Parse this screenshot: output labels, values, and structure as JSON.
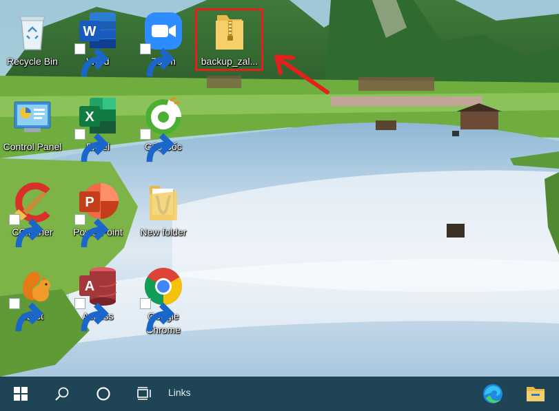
{
  "desktop": {
    "icons": [
      {
        "label": "Recycle Bin"
      },
      {
        "label": "Word"
      },
      {
        "label": "Zoom"
      },
      {
        "label": "backup_zal..."
      },
      {
        "label": "Control Panel"
      },
      {
        "label": "Excel"
      },
      {
        "label": "Cốc Cốc"
      },
      {
        "label": "CCleaner"
      },
      {
        "label": "PowerPoint"
      },
      {
        "label": "New folder"
      },
      {
        "label": "eDict"
      },
      {
        "label": "Access"
      },
      {
        "label": "Google Chrome"
      }
    ],
    "highlight_color": "#e3201b"
  },
  "taskbar": {
    "links_label": "Links",
    "background": "#1e4456"
  }
}
